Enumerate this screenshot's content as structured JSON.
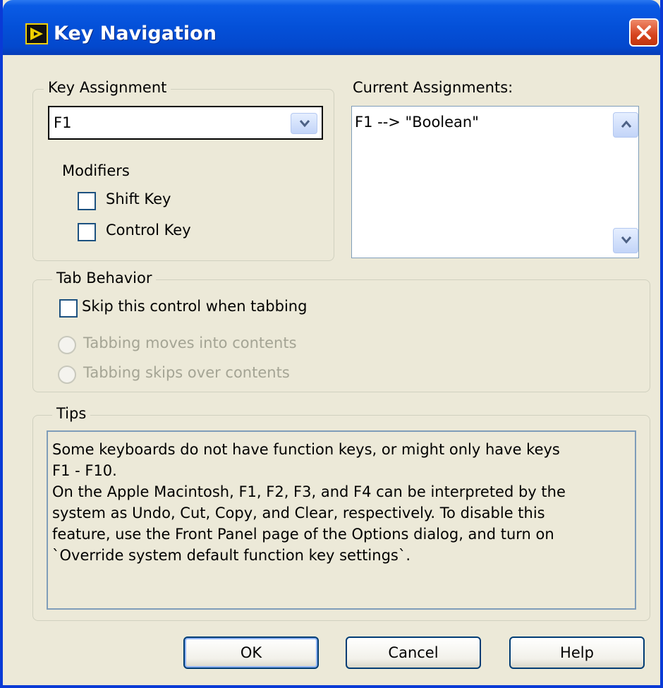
{
  "window": {
    "title": "Key Navigation"
  },
  "key_assignment": {
    "legend": "Key Assignment",
    "key_value": "F1",
    "modifiers_label": "Modifiers",
    "shift_label": "Shift Key",
    "shift_checked": false,
    "control_label": "Control Key",
    "control_checked": false
  },
  "current_assignments": {
    "label": "Current Assignments:",
    "items": [
      "F1 --> \"Boolean\""
    ]
  },
  "tab_behavior": {
    "legend": "Tab Behavior",
    "skip_label": "Skip this control when tabbing",
    "skip_checked": false,
    "into_label": "Tabbing moves into contents",
    "over_label": "Tabbing skips over contents"
  },
  "tips": {
    "legend": "Tips",
    "lines": [
      "Some keyboards do not have function keys, or might only have keys",
      "F1 - F10.",
      "On the Apple Macintosh, F1, F2, F3, and F4 can be interpreted by the",
      "system as Undo, Cut, Copy, and Clear, respectively.  To disable this",
      "feature, use the Front Panel page of the Options dialog, and turn on",
      "`Override system default function key settings`."
    ]
  },
  "buttons": {
    "ok": "OK",
    "cancel": "Cancel",
    "help": "Help"
  },
  "colors": {
    "titlebar": "#0450d8",
    "dialog_bg": "#ece9d8",
    "close": "#d6431e"
  }
}
